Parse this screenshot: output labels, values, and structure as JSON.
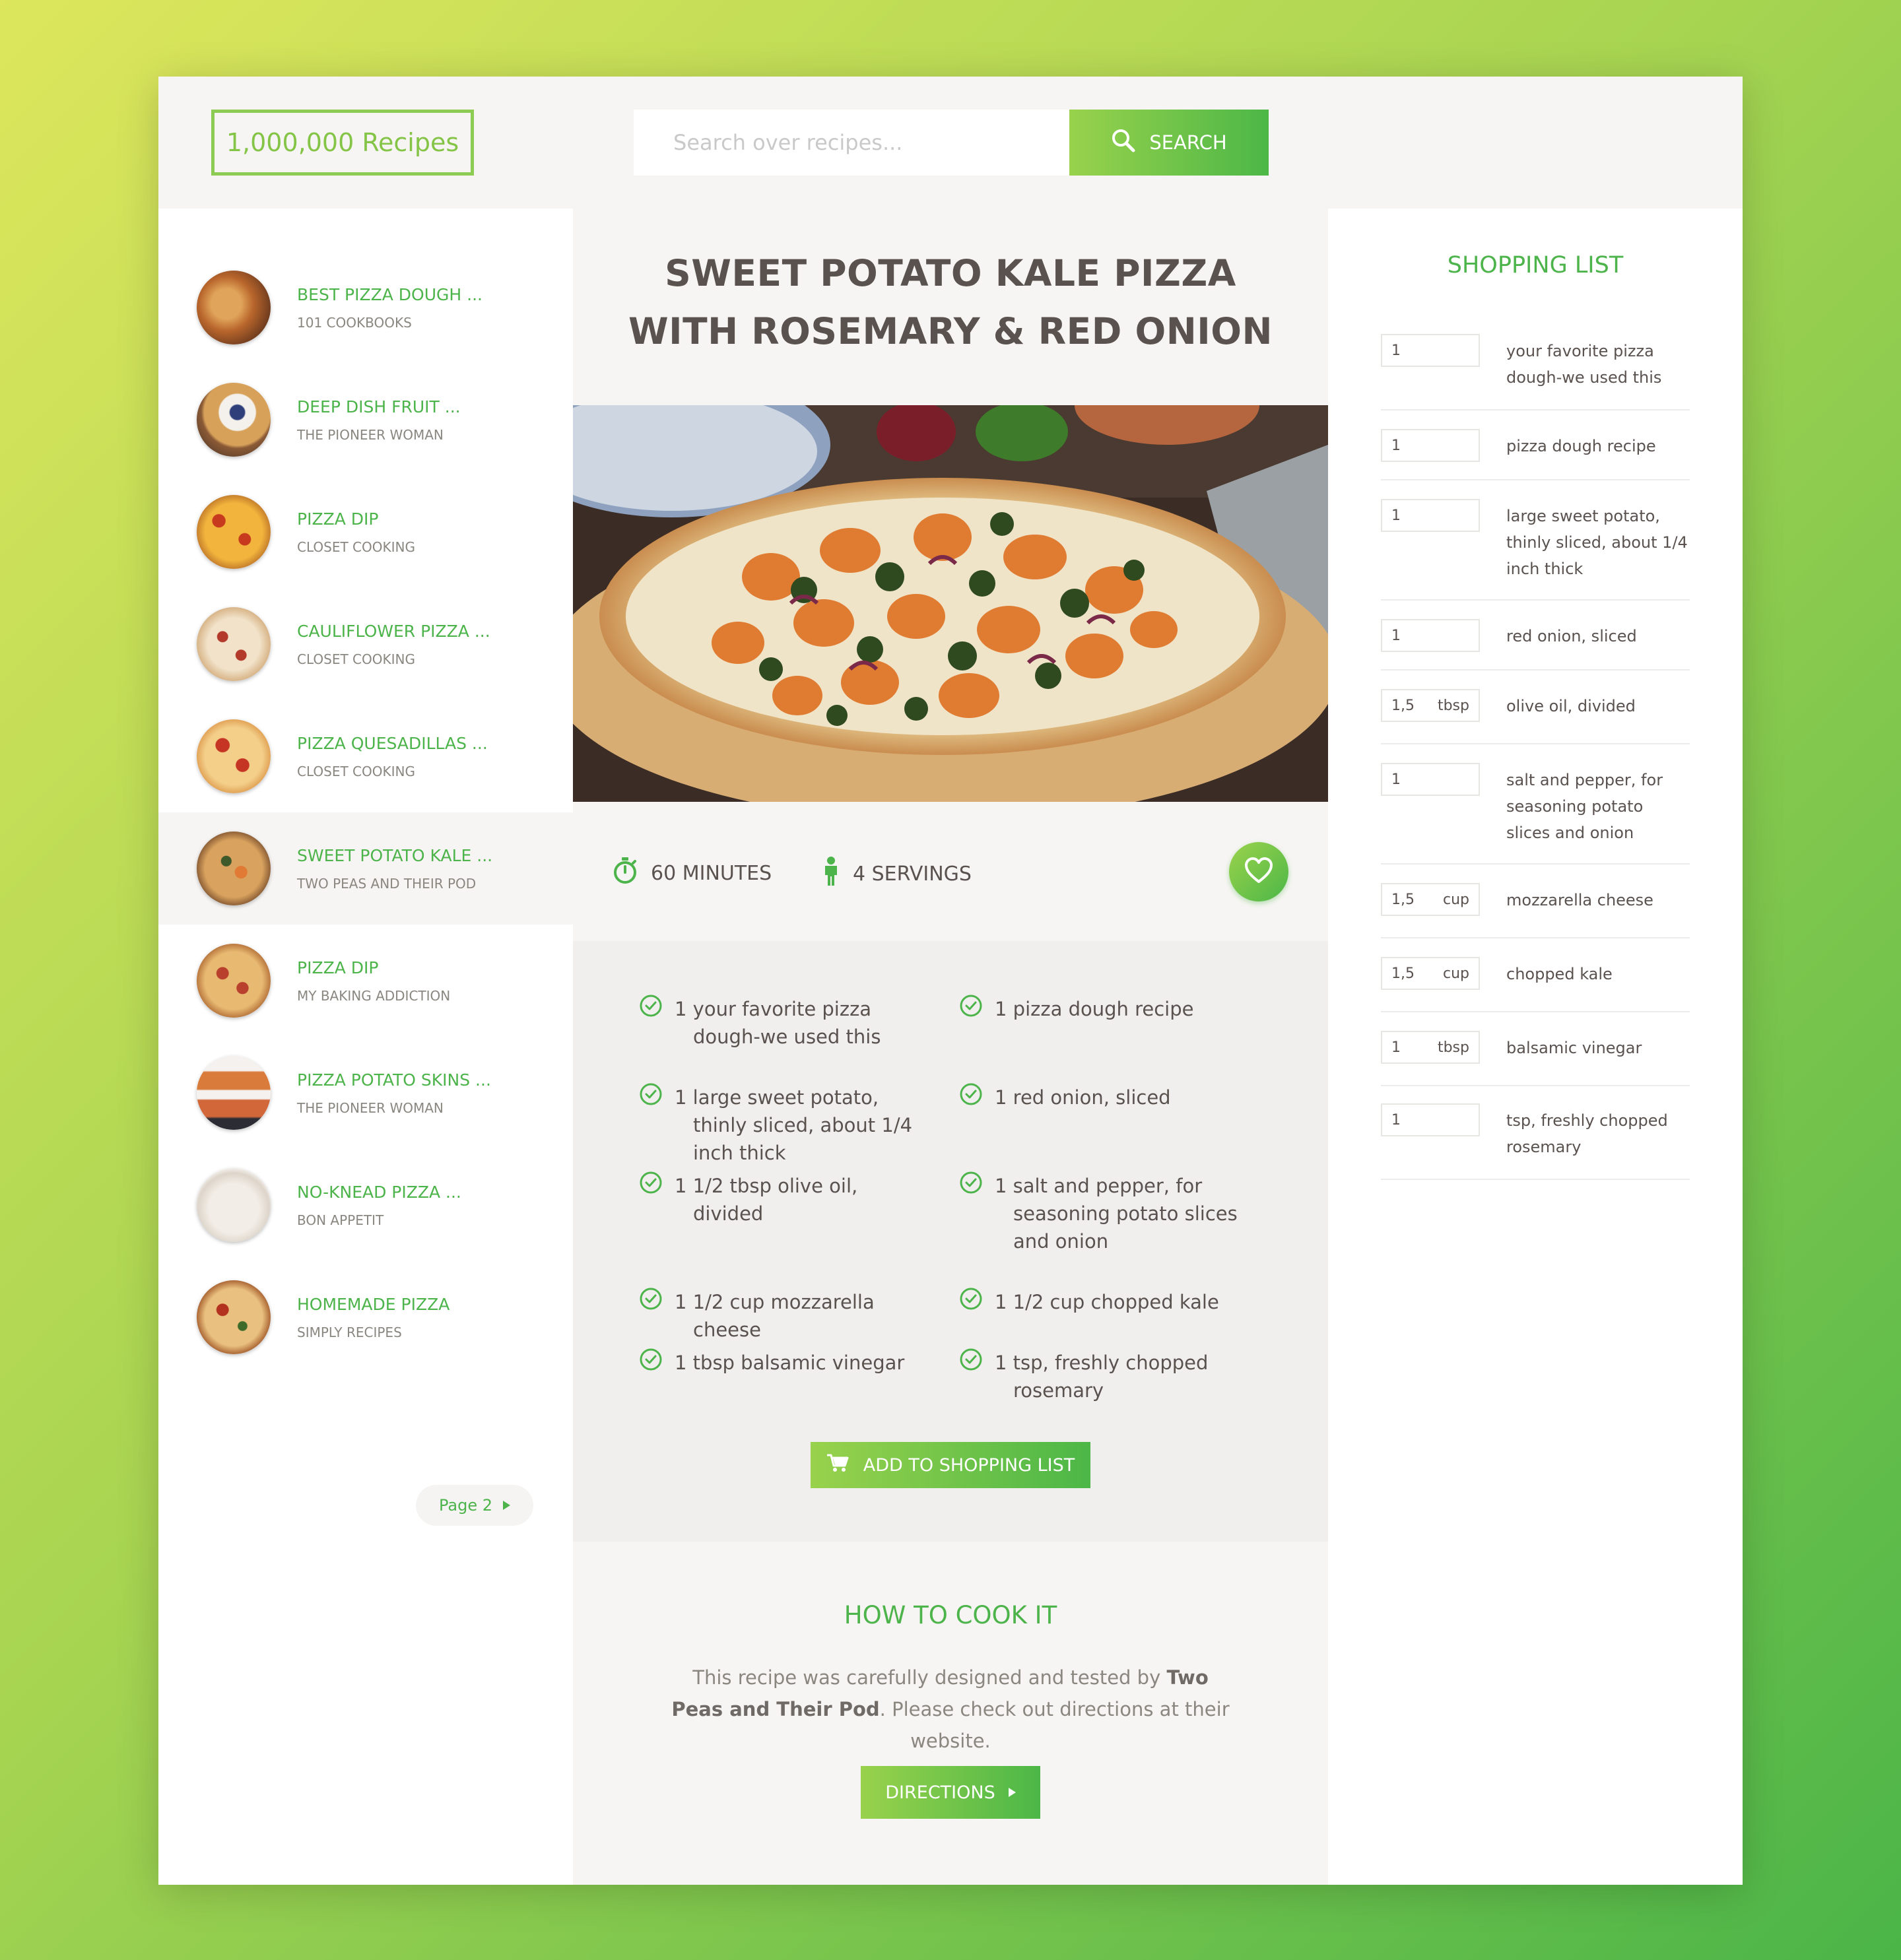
{
  "header": {
    "logo": "1,000,000 Recipes",
    "search_placeholder": "Search over recipes...",
    "search_label": "SEARCH"
  },
  "sidebar": {
    "items": [
      {
        "title": "BEST PIZZA DOUGH ...",
        "source": "101 COOKBOOKS",
        "active": false
      },
      {
        "title": "DEEP DISH FRUIT ...",
        "source": "THE PIONEER WOMAN",
        "active": false
      },
      {
        "title": "PIZZA DIP",
        "source": "CLOSET COOKING",
        "active": false
      },
      {
        "title": "CAULIFLOWER PIZZA ...",
        "source": "CLOSET COOKING",
        "active": false
      },
      {
        "title": "PIZZA QUESADILLAS ...",
        "source": "CLOSET COOKING",
        "active": false
      },
      {
        "title": "SWEET POTATO KALE ...",
        "source": "TWO PEAS AND THEIR POD",
        "active": true
      },
      {
        "title": "PIZZA DIP",
        "source": "MY BAKING ADDICTION",
        "active": false
      },
      {
        "title": "PIZZA POTATO SKINS ...",
        "source": "THE PIONEER WOMAN",
        "active": false
      },
      {
        "title": "NO-KNEAD PIZZA ...",
        "source": "BON APPETIT",
        "active": false
      },
      {
        "title": "HOMEMADE PIZZA",
        "source": "SIMPLY RECIPES",
        "active": false
      }
    ],
    "pager_label": "Page 2"
  },
  "recipe": {
    "title": "SWEET POTATO KALE PIZZA WITH ROSEMARY & RED ONION",
    "time": "60 MINUTES",
    "servings": "4 SERVINGS",
    "ingredients": [
      "1 your favorite pizza dough-we used this",
      "1 pizza dough recipe",
      "1 large sweet potato, thinly sliced, about 1/4 inch thick",
      "1 red onion, sliced",
      "1 1/2 tbsp olive oil, divided",
      "1 salt and pepper, for seasoning potato slices and onion",
      "1 1/2 cup mozzarella cheese",
      "1 1/2 cup chopped kale",
      "1 tbsp balsamic vinegar",
      "1 tsp, freshly chopped rosemary"
    ],
    "add_to_list_label": "ADD TO SHOPPING LIST",
    "how_to_title": "HOW TO COOK IT",
    "how_to_text_1": "This recipe was carefully designed and tested by ",
    "how_to_author": "Two Peas and Their Pod",
    "how_to_text_2": ". Please check out directions at their website.",
    "directions_label": "DIRECTIONS"
  },
  "shopping_list": {
    "title": "SHOPPING LIST",
    "items": [
      {
        "qty": "1",
        "unit": "",
        "name": "your favorite pizza dough-we used this"
      },
      {
        "qty": "1",
        "unit": "",
        "name": "pizza dough recipe"
      },
      {
        "qty": "1",
        "unit": "",
        "name": "large sweet potato, thinly sliced, about 1/4 inch thick"
      },
      {
        "qty": "1",
        "unit": "",
        "name": "red onion, sliced"
      },
      {
        "qty": "1,5",
        "unit": "tbsp",
        "name": "olive oil, divided"
      },
      {
        "qty": "1",
        "unit": "",
        "name": "salt and pepper, for seasoning potato slices and onion"
      },
      {
        "qty": "1,5",
        "unit": "cup",
        "name": "mozzarella cheese"
      },
      {
        "qty": "1,5",
        "unit": "cup",
        "name": "chopped kale"
      },
      {
        "qty": "1",
        "unit": "tbsp",
        "name": "balsamic vinegar"
      },
      {
        "qty": "1",
        "unit": "",
        "name": "tsp, freshly chopped rosemary"
      }
    ]
  },
  "colors": {
    "accent": "#4cb44a",
    "accent_light": "#99d24c",
    "text": "#5a524f",
    "muted": "#8a8680",
    "panel": "#f7f5f3"
  },
  "icons": {
    "search": "search-icon",
    "timer": "stopwatch-icon",
    "servings": "person-icon",
    "favorite": "heart-icon",
    "check": "check-circle-icon",
    "cart": "cart-icon",
    "next": "triangle-right-icon"
  }
}
